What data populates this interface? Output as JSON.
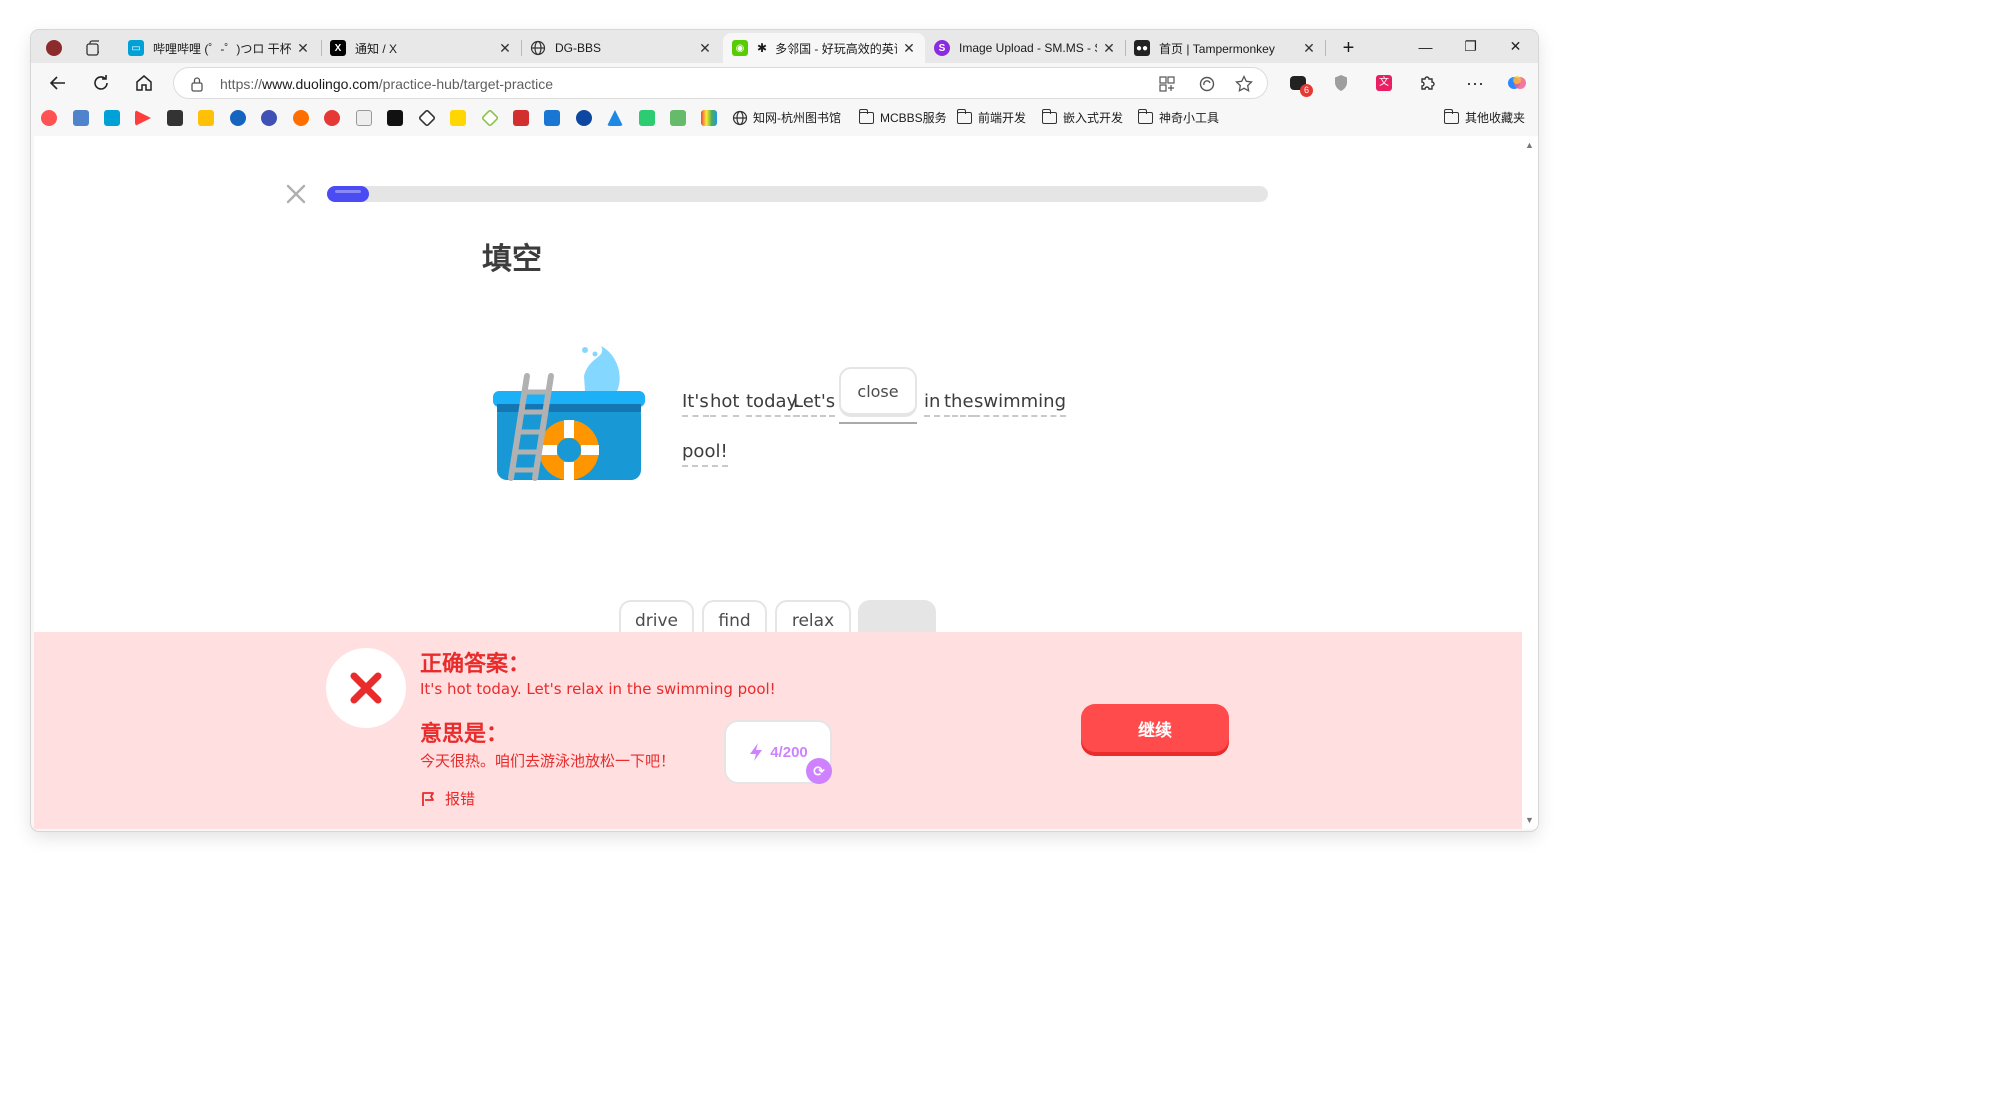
{
  "browser": {
    "tabs": [
      {
        "title": "哔哩哔哩 (゜-゜)つロ 干杯~",
        "color": "#fb7299"
      },
      {
        "title": "通知 / X",
        "color": "#000000"
      },
      {
        "title": "DG-BBS",
        "color": "#777777"
      },
      {
        "title": "多邻国 - 好玩高效的英语",
        "color": "#58cc02"
      },
      {
        "title": "Image Upload - SM.MS - Si",
        "color": "#8a2be2"
      },
      {
        "title": "首页 | Tampermonkey",
        "color": "#222222"
      }
    ],
    "url_prefix": "https://",
    "url_domain": "www.duolingo.com",
    "url_path": "/practice-hub/target-practice",
    "extension_badge": "6",
    "bookmark_folders": [
      "知网-杭州图书馆",
      "MCBBS服务",
      "前端开发",
      "嵌入式开发",
      "神奇小工具"
    ],
    "other_bookmarks": "其他收藏夹"
  },
  "lesson": {
    "progress": 0.045,
    "heading": "填空",
    "sentence_part1": "It's",
    "sentence_part2": "hot",
    "sentence_part3": "today.",
    "sentence_part4": "Let's",
    "blank_answer": "close",
    "sentence_part5": "in",
    "sentence_part6": "the",
    "sentence_part7": "swimming",
    "sentence_part8": "pool!",
    "choices": [
      "drive",
      "find",
      "relax"
    ]
  },
  "feedback": {
    "title": "正确答案：",
    "correct_answer": "It's hot today. Let's relax in the swimming pool!",
    "meaning_title": "意思是：",
    "meaning": "今天很热。咱们去游泳池放松一下吧！",
    "report": "报错",
    "xp": "4/200",
    "continue": "继续"
  },
  "colors": {
    "accent": "#4b4bf4",
    "error": "#ea2b2b",
    "feedback_bg": "#ffdfe0",
    "button": "#ff4b4b"
  }
}
